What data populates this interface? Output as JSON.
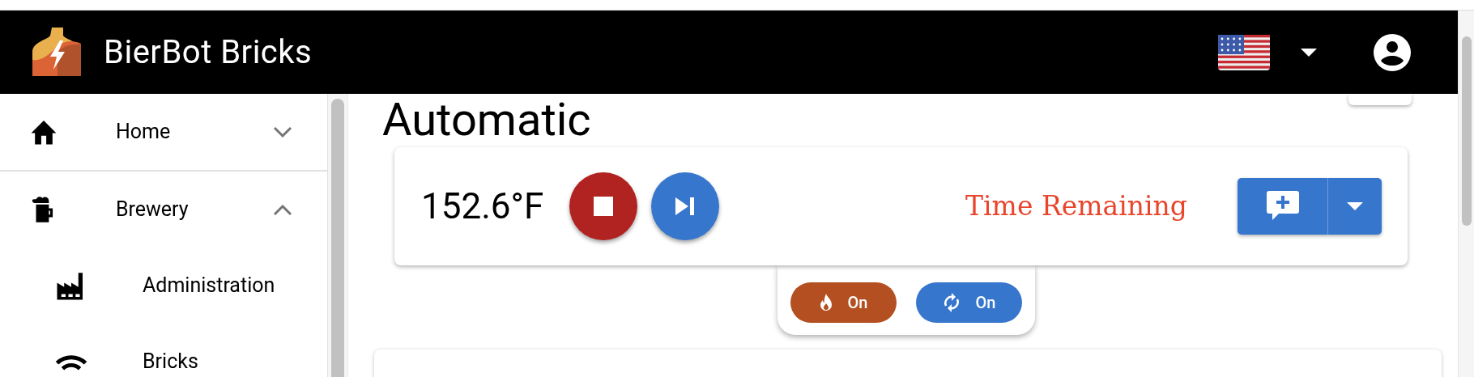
{
  "header": {
    "title": "BierBot Bricks"
  },
  "sidebar": {
    "items": [
      {
        "label": "Home",
        "kind": "home",
        "expanded": false
      },
      {
        "label": "Brewery",
        "kind": "beer",
        "expanded": true,
        "children": [
          {
            "label": "Administration",
            "kind": "factory"
          },
          {
            "label": "Bricks",
            "kind": "wifi"
          }
        ]
      }
    ]
  },
  "main": {
    "heading": "Automatic",
    "controller": {
      "temperature": "152.6°F",
      "status": "Time Remaining"
    },
    "toggles": [
      {
        "kind": "heating",
        "label": "On",
        "color": "#b34f20"
      },
      {
        "kind": "pump",
        "label": "On",
        "color": "#3676cc"
      }
    ]
  }
}
